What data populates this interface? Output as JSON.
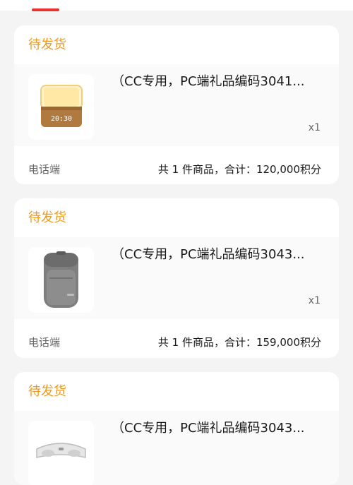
{
  "colors": {
    "accent_red": "#e8322b",
    "status_orange": "#f09a1e",
    "page_bg": "#f4f4f4"
  },
  "orders": [
    {
      "status": "待发货",
      "product_name": "（CC专用，PC端礼品编码3041...",
      "product_icon": "wooden-lamp-clock-icon",
      "thumb_clock_text": "20:30",
      "quantity": "x1",
      "source": "电话端",
      "summary": "共 1 件商品，合计：120,000积分"
    },
    {
      "status": "待发货",
      "product_name": "（CC专用，PC端礼品编码3043...",
      "product_icon": "gray-backpack-icon",
      "quantity": "x1",
      "source": "电话端",
      "summary": "共 1 件商品，合计：159,000积分"
    },
    {
      "status": "待发货",
      "product_name": "（CC专用，PC端礼品编码3043...",
      "product_icon": "eye-massager-icon"
    }
  ]
}
